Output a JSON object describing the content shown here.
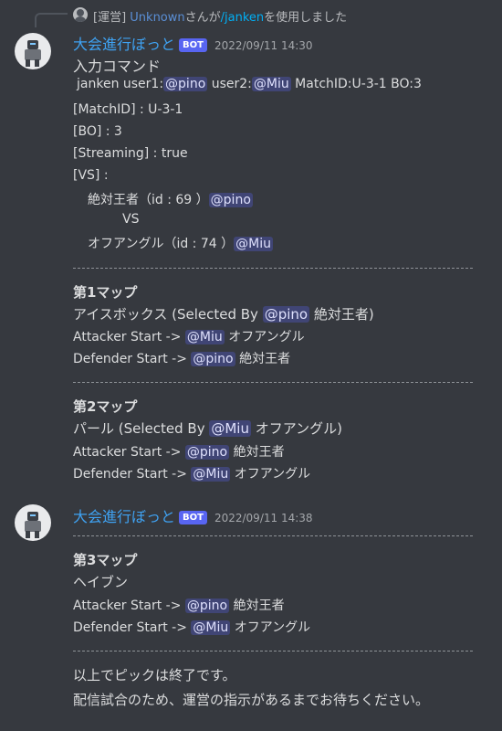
{
  "reply": {
    "prefix": "[運営] ",
    "user": "Unknown",
    "middle": "さんが",
    "command": "/janken",
    "suffix": "を使用しました"
  },
  "msg1": {
    "username": "大会進行ぼっと",
    "bot_tag": "BOT",
    "timestamp": "2022/09/11 14:30",
    "input_label": "入力コマンド",
    "cmd_pre1": "janken user1:",
    "cmd_m1": "@pino",
    "cmd_pre2": " user2:",
    "cmd_m2": "@Miu",
    "cmd_post": " MatchID:U-3-1 BO:3",
    "matchid": "[MatchID] : U-3-1",
    "bo": "[BO] : 3",
    "streaming": "[Streaming] : true",
    "vs_label": "[VS] :",
    "team1": "絶対王者（id : 69 ）",
    "team1_mention": "@pino",
    "vs": "VS",
    "team2": "オフアングル（id : 74 ）",
    "team2_mention": "@Miu",
    "map1_title": "第1マップ",
    "map1_name": "アイスボックス (Selected By ",
    "map1_mention": "@pino",
    "map1_team": " 絶対王者)",
    "map1_att_label": "Attacker Start -> ",
    "map1_att_mention": "@Miu",
    "map1_att_team": " オフアングル",
    "map1_def_label": "Defender Start -> ",
    "map1_def_mention": "@pino",
    "map1_def_team": " 絶対王者",
    "map2_title": "第2マップ",
    "map2_name": "パール (Selected By ",
    "map2_mention": "@Miu",
    "map2_team": " オフアングル)",
    "map2_att_label": "Attacker Start -> ",
    "map2_att_mention": "@pino",
    "map2_att_team": " 絶対王者",
    "map2_def_label": "Defender Start -> ",
    "map2_def_mention": "@Miu",
    "map2_def_team": " オフアングル"
  },
  "msg2": {
    "username": "大会進行ぼっと",
    "bot_tag": "BOT",
    "timestamp": "2022/09/11 14:38",
    "map3_title": "第3マップ",
    "map3_name": "ヘイブン",
    "map3_att_label": "Attacker Start -> ",
    "map3_att_mention": "@pino",
    "map3_att_team": " 絶対王者",
    "map3_def_label": "Defender Start -> ",
    "map3_def_mention": "@Miu",
    "map3_def_team": " オフアングル",
    "end1": "以上でピックは終了です。",
    "end2": "配信試合のため、運営の指示があるまでお待ちください。"
  }
}
